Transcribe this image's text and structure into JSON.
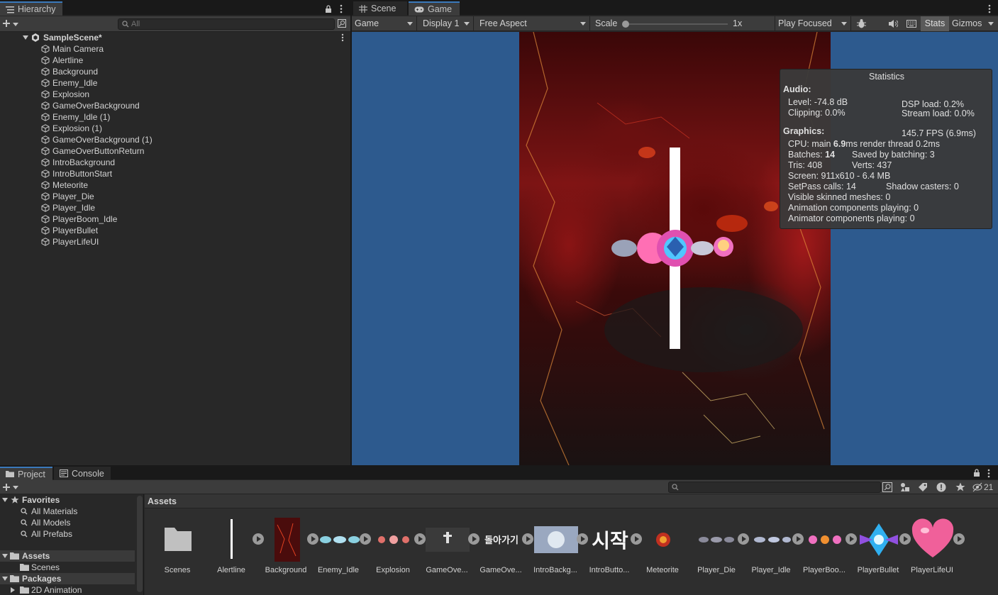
{
  "hierarchy": {
    "tab_label": "Hierarchy",
    "search_placeholder": "All",
    "scene_name": "SampleScene*",
    "objects": [
      "Main Camera",
      "Alertline",
      "Background",
      "Enemy_Idle",
      "Explosion",
      "GameOverBackground",
      "Enemy_Idle (1)",
      "Explosion (1)",
      "GameOverBackground (1)",
      "GameOverButtonReturn",
      "IntroBackground",
      "IntroButtonStart",
      "Meteorite",
      "Player_Die",
      "Player_Idle",
      "PlayerBoom_Idle",
      "PlayerBullet",
      "PlayerLifeUI"
    ]
  },
  "gameview": {
    "tabs": {
      "scene": "Scene",
      "game": "Game"
    },
    "toolbar": {
      "mode": "Game",
      "display": "Display 1",
      "aspect": "Free Aspect",
      "scale_label": "Scale",
      "scale_value": "1x",
      "play_mode": "Play Focused",
      "stats": "Stats",
      "gizmos": "Gizmos"
    },
    "stats": {
      "title": "Statistics",
      "audio_header": "Audio:",
      "level": "Level: -74.8 dB",
      "clipping": "Clipping: 0.0%",
      "dsp_load": "DSP load: 0.2%",
      "stream_load": "Stream load: 0.0%",
      "graphics_header": "Graphics:",
      "fps": "145.7 FPS (6.9ms)",
      "cpu_prefix": "CPU: main ",
      "cpu_main": "6.9",
      "cpu_suffix": "ms  render thread 0.2ms",
      "batches_prefix": "Batches: ",
      "batches": "14",
      "saved_batching": "Saved by batching: 3",
      "tris": "Tris: 408",
      "verts": "Verts: 437",
      "screen": "Screen: 911x610 - 6.4 MB",
      "setpass": "SetPass calls: 14",
      "shadow_casters": "Shadow casters: 0",
      "skinned": "Visible skinned meshes: 0",
      "animation": "Animation components playing: 0",
      "animator": "Animator components playing: 0"
    }
  },
  "project": {
    "tabs": {
      "project": "Project",
      "console": "Console"
    },
    "hidden_count": "21",
    "tree": {
      "favorites": "Favorites",
      "all_materials": "All Materials",
      "all_models": "All Models",
      "all_prefabs": "All Prefabs",
      "assets": "Assets",
      "scenes": "Scenes",
      "packages": "Packages",
      "anim2d": "2D Animation"
    },
    "breadcrumb": "Assets",
    "assets": [
      "Scenes",
      "Alertline",
      "Background",
      "Enemy_Idle",
      "Explosion",
      "GameOve...",
      "GameOve...",
      "IntroBackg...",
      "IntroButto...",
      "Meteorite",
      "Player_Die",
      "Player_Idle",
      "PlayerBoo...",
      "PlayerBullet",
      "PlayerLifeUI"
    ],
    "thumb_texts": {
      "return": "돌아가기",
      "start": "시작"
    }
  },
  "colors": {
    "accent": "#3a79bb",
    "panel": "#282828",
    "toolbar": "#3c3c3c",
    "game_bg": "#2d5a8e"
  }
}
